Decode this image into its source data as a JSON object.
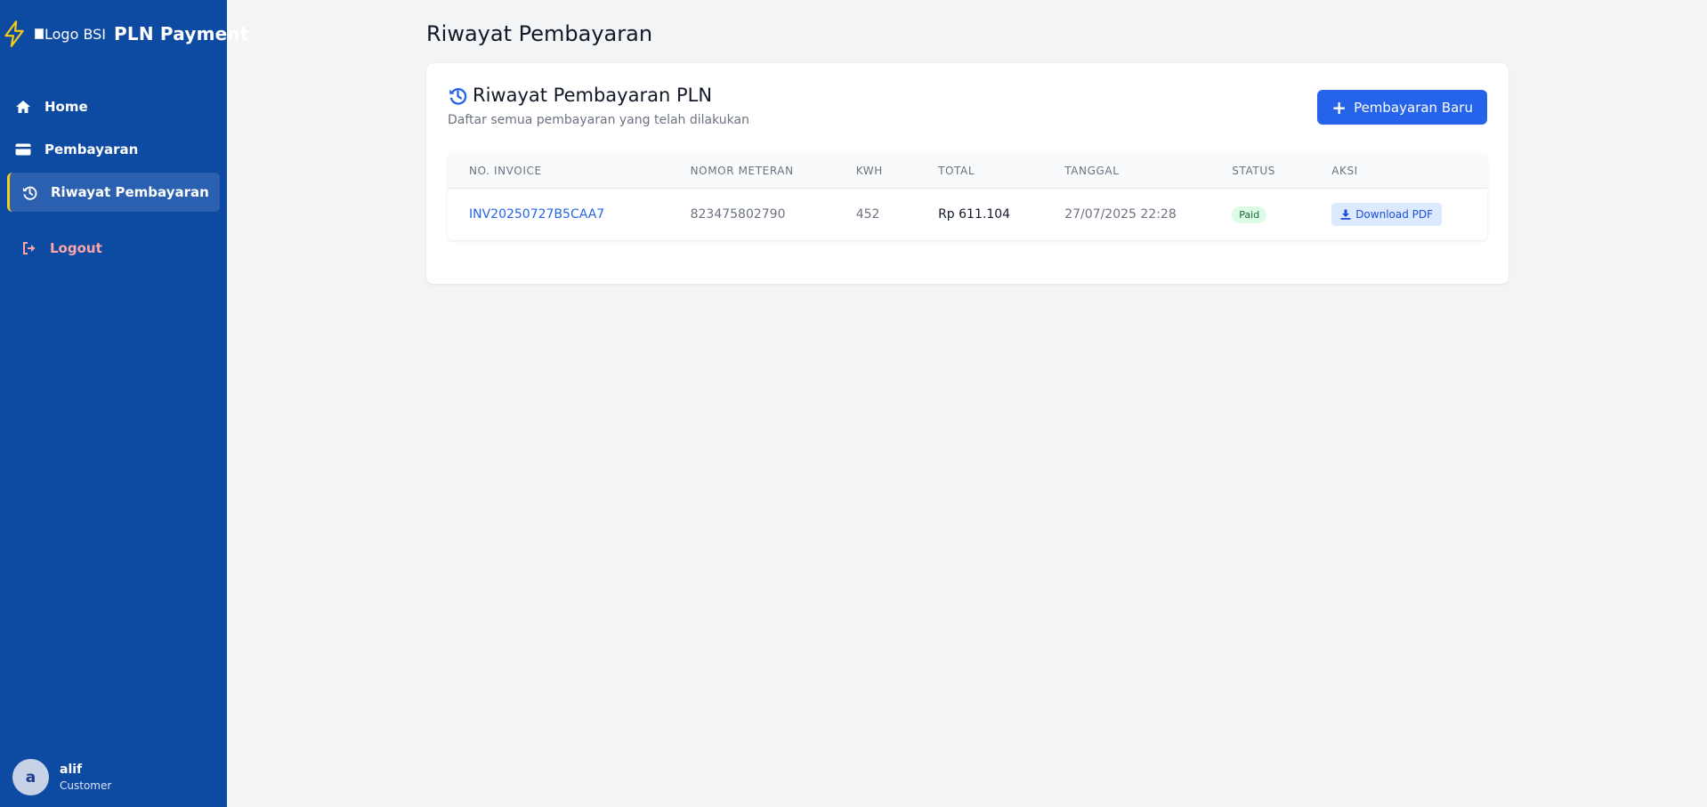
{
  "colors": {
    "sidebar_bg": "#0d4aa2",
    "accent_yellow": "#facc15",
    "primary_blue": "#2563eb",
    "logout_red": "#fca5a5",
    "paid_green": "#166534"
  },
  "sidebar": {
    "logo_alt": "Logo BSI",
    "brand": "PLN Payment",
    "brand_icon": "lightning-bolt-icon",
    "items": [
      {
        "label": "Home",
        "icon": "home-icon",
        "active": false
      },
      {
        "label": "Pembayaran",
        "icon": "credit-card-icon",
        "active": false
      },
      {
        "label": "Riwayat Pembayaran",
        "icon": "history-icon",
        "active": true
      }
    ],
    "logout": {
      "label": "Logout",
      "icon": "sign-out-icon"
    },
    "user": {
      "initial": "a",
      "name": "alif",
      "role": "Customer"
    }
  },
  "main": {
    "page_title": "Riwayat Pembayaran",
    "card": {
      "title": "Riwayat Pembayaran PLN",
      "subtitle": "Daftar semua pembayaran yang telah dilakukan",
      "new_button": "Pembayaran Baru"
    },
    "table": {
      "headers": [
        "NO. INVOICE",
        "NOMOR METERAN",
        "KWH",
        "TOTAL",
        "TANGGAL",
        "STATUS",
        "AKSI"
      ],
      "rows": [
        {
          "invoice": "INV20250727B5CAA7",
          "meter": "823475802790",
          "kwh": "452",
          "total": "Rp 611.104",
          "date": "27/07/2025 22:28",
          "status": "Paid",
          "action": "Download PDF"
        }
      ]
    }
  }
}
